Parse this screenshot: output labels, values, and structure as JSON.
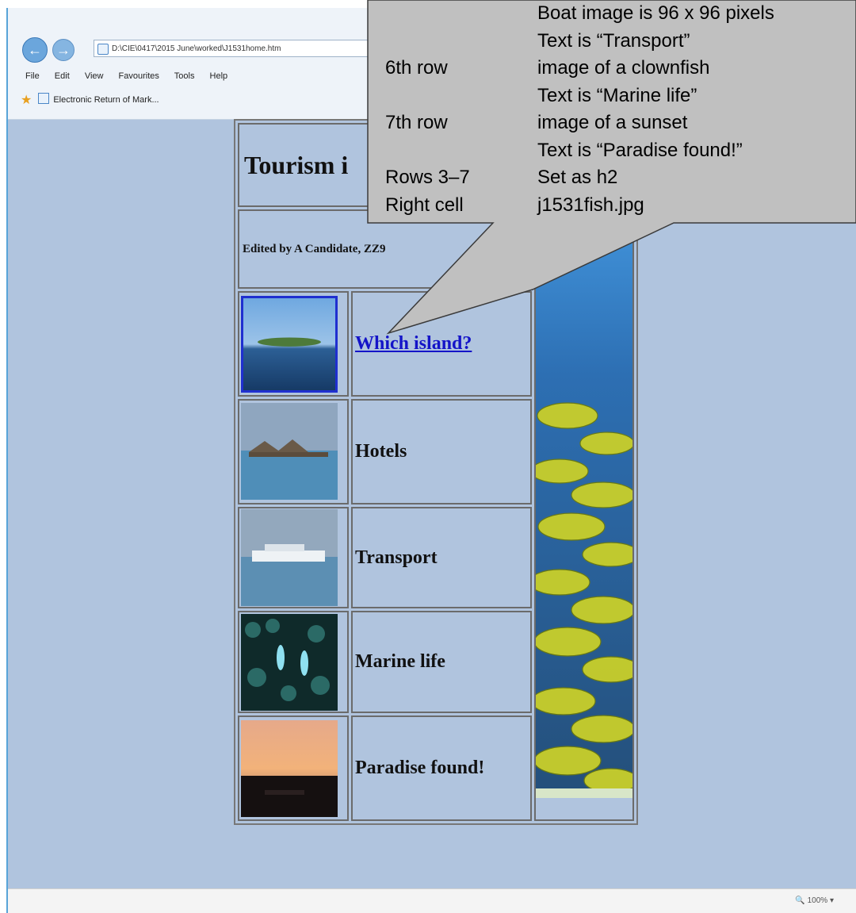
{
  "browser": {
    "address": "D:\\CIE\\0417\\2015 June\\worked\\J1531home.htm",
    "menu": [
      "File",
      "Edit",
      "View",
      "Favourites",
      "Tools",
      "Help"
    ],
    "favourite": "Electronic Return of Mark...",
    "zoom": "100%"
  },
  "page": {
    "title": "Tourism i",
    "editor": "Edited by A Candidate, ZZ9",
    "rows": [
      {
        "label": "Which island?",
        "link": true
      },
      {
        "label": "Hotels",
        "link": false
      },
      {
        "label": "Transport",
        "link": false
      },
      {
        "label": "Marine life",
        "link": false
      },
      {
        "label": "Paradise found!",
        "link": false
      }
    ]
  },
  "callout": {
    "lines": [
      {
        "col1": "",
        "col2": "Boat image is 96 x 96 pixels"
      },
      {
        "col1": "",
        "col2": "Text is “Transport”"
      },
      {
        "col1": "6th row",
        "col2": "image of a clownfish"
      },
      {
        "col1": "",
        "col2": "Text is “Marine life”"
      },
      {
        "col1": "7th row",
        "col2": "image of a sunset"
      },
      {
        "col1": "",
        "col2": "Text is “Paradise found!”"
      },
      {
        "col1": "Rows 3–7",
        "col2": "Set as h2"
      },
      {
        "col1": "Right cell",
        "col2": "j1531fish.jpg"
      }
    ]
  },
  "colors": {
    "page_background": "#b0c4de",
    "link": "#1414c8",
    "callout_fill": "#c0c0c0"
  }
}
